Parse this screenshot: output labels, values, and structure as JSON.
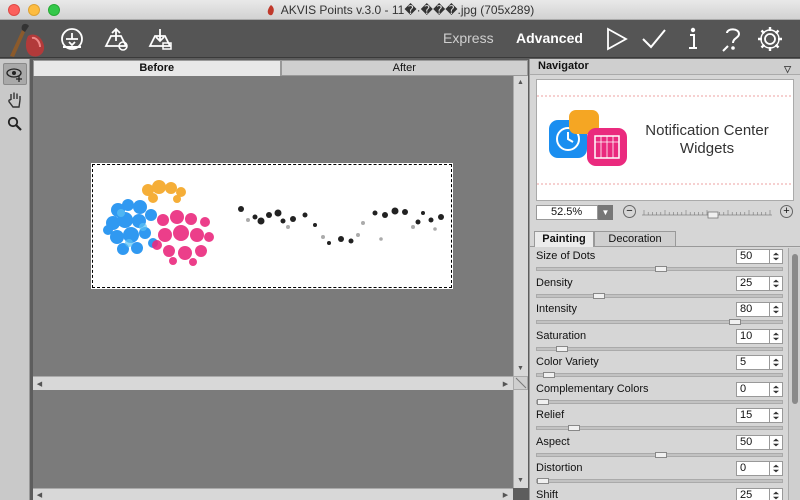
{
  "window": {
    "title": "AKVIS Points v.3.0 - 11�·���.jpg (705x289)"
  },
  "toolbar": {
    "mode_express": "Express",
    "mode_advanced": "Advanced",
    "active_mode": "Advanced",
    "buttons": [
      "open-image-icon",
      "save-image-icon",
      "print-image-icon",
      "run-icon",
      "apply-icon",
      "info-icon",
      "help-icon",
      "settings-icon"
    ]
  },
  "tools": [
    "toggle-view-icon",
    "hand-icon",
    "zoom-icon"
  ],
  "canvas": {
    "tabs": [
      {
        "label": "Before",
        "active": true
      },
      {
        "label": "After",
        "active": false
      }
    ]
  },
  "navigator": {
    "title": "Navigator",
    "preview_text_line1": "Notification Center",
    "preview_text_line2": "Widgets",
    "zoom": "52.5%",
    "zoom_level": 0.55
  },
  "settings_tabs": [
    {
      "label": "Painting",
      "active": true
    },
    {
      "label": "Decoration",
      "active": false
    }
  ],
  "parameters": [
    {
      "label": "Size of Dots",
      "value": "50",
      "level": 0.5
    },
    {
      "label": "Density",
      "value": "25",
      "level": 0.25
    },
    {
      "label": "Intensity",
      "value": "80",
      "level": 0.8
    },
    {
      "label": "Saturation",
      "value": "10",
      "level": 0.1
    },
    {
      "label": "Color Variety",
      "value": "5",
      "level": 0.05
    },
    {
      "label": "Complementary Colors",
      "value": "0",
      "level": 0.0
    },
    {
      "label": "Relief",
      "value": "15",
      "level": 0.15
    },
    {
      "label": "Aspect",
      "value": "50",
      "level": 0.5
    },
    {
      "label": "Distortion",
      "value": "0",
      "level": 0.0
    },
    {
      "label": "Shift",
      "value": "25",
      "level": 0.25
    }
  ]
}
